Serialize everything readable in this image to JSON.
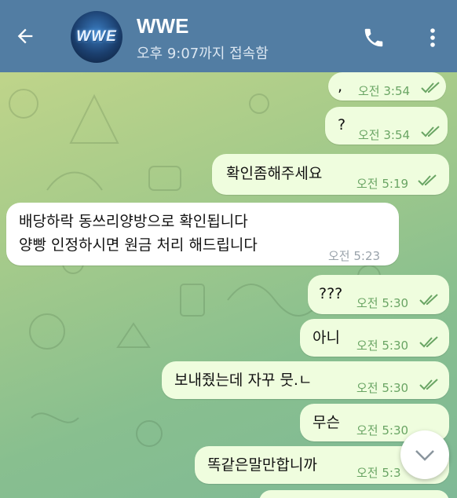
{
  "header": {
    "title": "WWE",
    "status": "오후 9:07까지 접속함",
    "avatar_text": "WWE"
  },
  "messages": [
    {
      "dir": "out",
      "text": ",",
      "time": "오전 3:54"
    },
    {
      "dir": "out",
      "text": "?",
      "time": "오전 3:54"
    },
    {
      "dir": "out",
      "text": "확인좀해주세요",
      "time": "오전 5:19"
    },
    {
      "dir": "in",
      "line1": "배당하락 동쓰리양방으로 확인됩니다",
      "line2": "양빵 인정하시면 원금 처리 해드립니다",
      "time": "오전 5:23"
    },
    {
      "dir": "out",
      "text": "???",
      "time": "오전 5:30"
    },
    {
      "dir": "out",
      "text": "아니",
      "time": "오전 5:30"
    },
    {
      "dir": "out",
      "text": "보내줬는데 자꾸 뭇.ㄴ",
      "time": "오전 5:30"
    },
    {
      "dir": "out",
      "text": "무슨",
      "time": "오전 5:30"
    },
    {
      "dir": "out",
      "text": "똑같은말만합니까",
      "time": "오전 5:3"
    }
  ],
  "colors": {
    "header_bg": "#527da3",
    "outgoing_bubble": "#effdde",
    "incoming_bubble": "#ffffff",
    "time_green": "#6aa564"
  },
  "icons": [
    "back-arrow-icon",
    "phone-icon",
    "more-vert-icon",
    "double-check-icon",
    "chevron-down-icon"
  ]
}
